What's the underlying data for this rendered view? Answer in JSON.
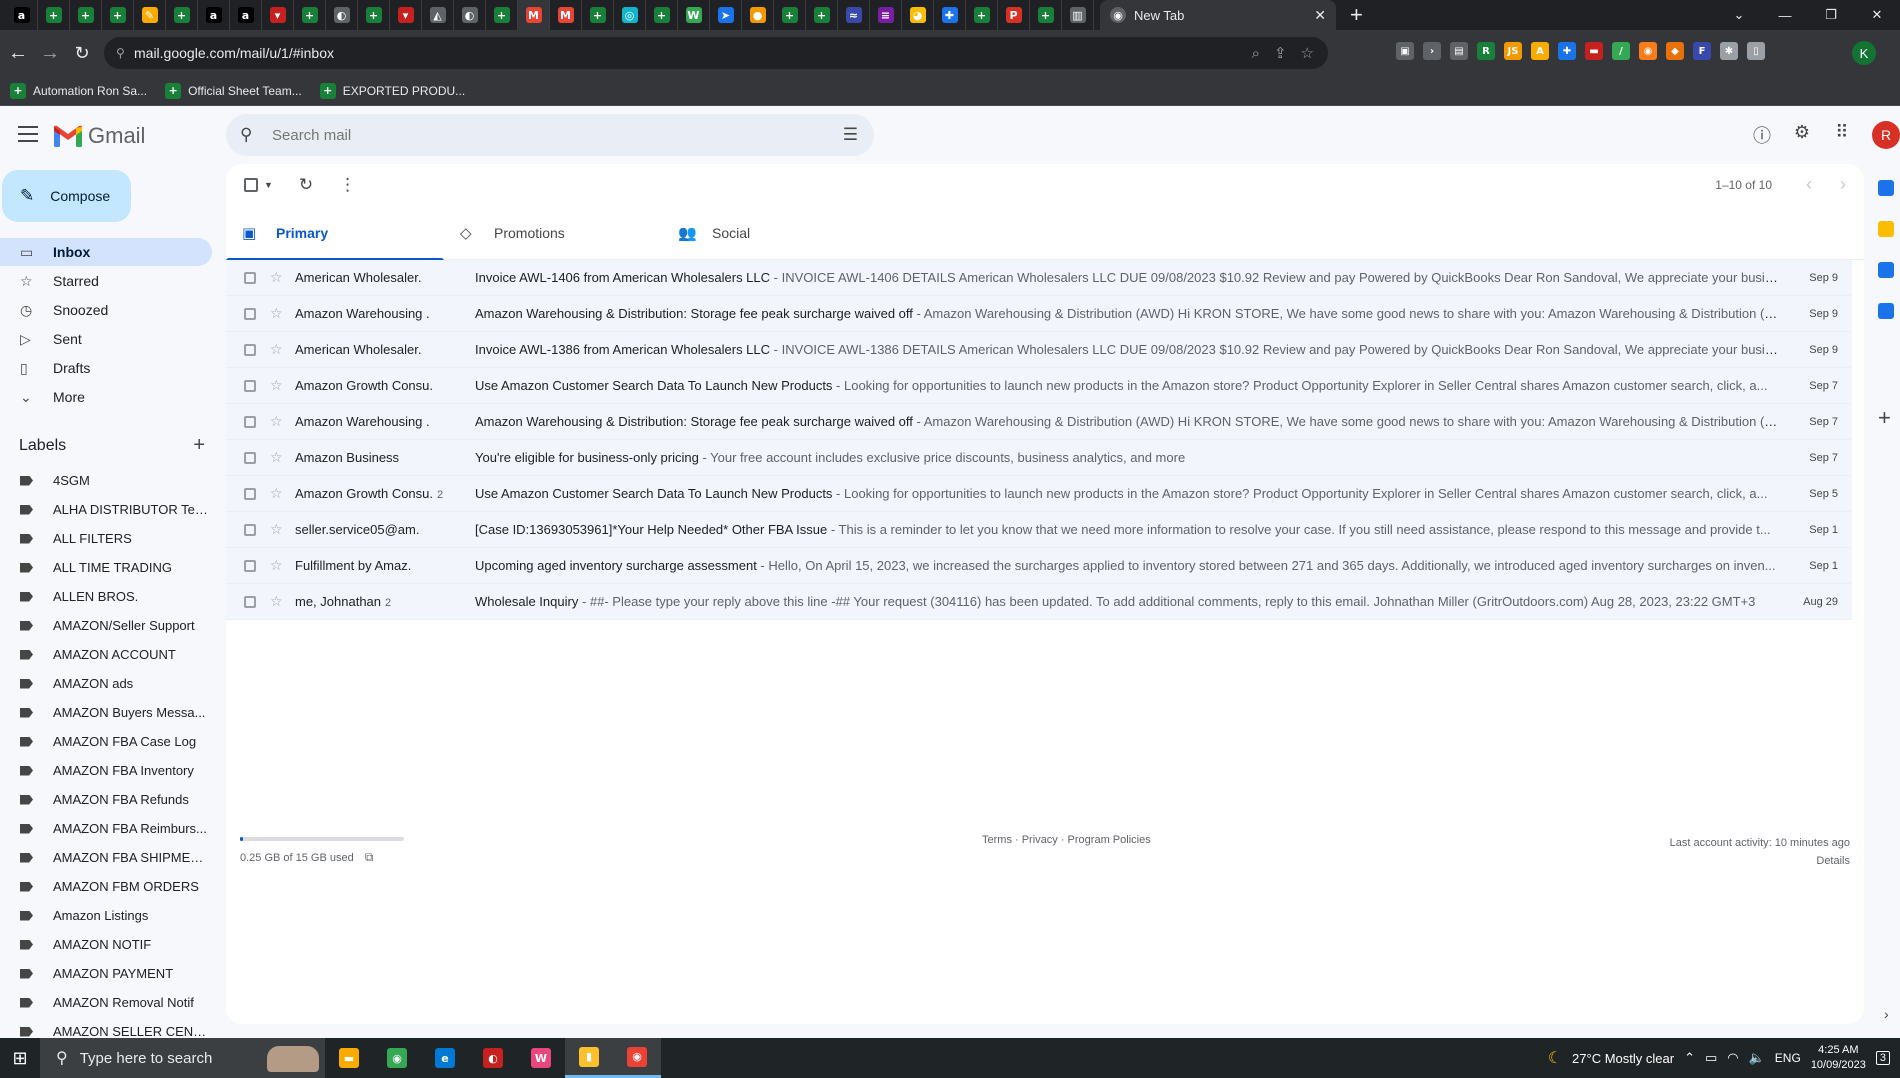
{
  "browser": {
    "pinned_tabs": [
      {
        "glyph": "a",
        "color": "#000000"
      },
      {
        "glyph": "+",
        "color": "#188038"
      },
      {
        "glyph": "+",
        "color": "#188038"
      },
      {
        "glyph": "+",
        "color": "#188038"
      },
      {
        "glyph": "✎",
        "color": "#f9ab00"
      },
      {
        "glyph": "+",
        "color": "#188038"
      },
      {
        "glyph": "a",
        "color": "#000000"
      },
      {
        "glyph": "a",
        "color": "#000000"
      },
      {
        "glyph": "▾",
        "color": "#c5221f"
      },
      {
        "glyph": "+",
        "color": "#188038"
      },
      {
        "glyph": "◐",
        "color": "#5f6368"
      },
      {
        "glyph": "+",
        "color": "#188038"
      },
      {
        "glyph": "▾",
        "color": "#c5221f"
      },
      {
        "glyph": "◭",
        "color": "#5f6368"
      },
      {
        "glyph": "◐",
        "color": "#5f6368"
      },
      {
        "glyph": "+",
        "color": "#188038"
      },
      {
        "glyph": "M",
        "color": "#ea4335"
      },
      {
        "glyph": "M",
        "color": "#ea4335"
      },
      {
        "glyph": "+",
        "color": "#188038"
      },
      {
        "glyph": "◎",
        "color": "#12b5cb"
      },
      {
        "glyph": "+",
        "color": "#188038"
      },
      {
        "glyph": "W",
        "color": "#34a853"
      },
      {
        "glyph": "➤",
        "color": "#1a73e8"
      },
      {
        "glyph": "●",
        "color": "#f29900"
      },
      {
        "glyph": "+",
        "color": "#188038"
      },
      {
        "glyph": "+",
        "color": "#188038"
      },
      {
        "glyph": "≈",
        "color": "#3949ab"
      },
      {
        "glyph": "≡",
        "color": "#7b1fa2"
      },
      {
        "glyph": "◕",
        "color": "#fbbc04"
      },
      {
        "glyph": "✚",
        "color": "#1a73e8"
      },
      {
        "glyph": "+",
        "color": "#188038"
      },
      {
        "glyph": "P",
        "color": "#d93025"
      },
      {
        "glyph": "+",
        "color": "#188038"
      },
      {
        "glyph": "▥",
        "color": "#5f6368"
      }
    ],
    "active_tab_index": 16,
    "new_tab_label": "New Tab",
    "url": "mail.google.com/mail/u/1/#inbox",
    "profile_initial": "K",
    "bookmarks": [
      "Automation Ron Sa...",
      "Official Sheet Team...",
      "EXPORTED PRODU..."
    ],
    "extensions": [
      {
        "glyph": "▣",
        "color": "#5f6368"
      },
      {
        "glyph": "›",
        "color": "#5f6368"
      },
      {
        "glyph": "▤",
        "color": "#5f6368"
      },
      {
        "glyph": "R",
        "color": "#188038"
      },
      {
        "glyph": "JS",
        "color": "#f29900"
      },
      {
        "glyph": "A",
        "color": "#f9ab00"
      },
      {
        "glyph": "✚",
        "color": "#1a73e8"
      },
      {
        "glyph": "▬",
        "color": "#c5221f"
      },
      {
        "glyph": "/",
        "color": "#34a853"
      },
      {
        "glyph": "◉",
        "color": "#fa7b17"
      },
      {
        "glyph": "◆",
        "color": "#e8710a"
      },
      {
        "glyph": "F",
        "color": "#3949ab"
      },
      {
        "glyph": "✱",
        "color": "#9aa0a6"
      },
      {
        "glyph": "▯",
        "color": "#9aa0a6"
      }
    ]
  },
  "gmail": {
    "product_name": "Gmail",
    "search_placeholder": "Search mail",
    "compose_label": "Compose",
    "account_initial": "R",
    "nav": [
      {
        "label": "Inbox",
        "icon": "▭",
        "selected": true
      },
      {
        "label": "Starred",
        "icon": "☆",
        "selected": false
      },
      {
        "label": "Snoozed",
        "icon": "◷",
        "selected": false
      },
      {
        "label": "Sent",
        "icon": "▷",
        "selected": false
      },
      {
        "label": "Drafts",
        "icon": "▯",
        "selected": false
      },
      {
        "label": "More",
        "icon": "⌄",
        "selected": false
      }
    ],
    "labels_title": "Labels",
    "labels": [
      "4SGM",
      "ALHA DISTRIBUTOR Tea...",
      "ALL FILTERS",
      "ALL TIME TRADING",
      "ALLEN BROS.",
      "AMAZON/Seller Support",
      "AMAZON ACCOUNT",
      "AMAZON ads",
      "AMAZON Buyers Messa...",
      "AMAZON FBA Case Log",
      "AMAZON FBA Inventory",
      "AMAZON FBA Refunds",
      "AMAZON FBA Reimburs...",
      "AMAZON FBA SHIPMEN...",
      "AMAZON FBM ORDERS",
      "Amazon Listings",
      "AMAZON NOTIF",
      "AMAZON PAYMENT",
      "AMAZON Removal Notif",
      "AMAZON SELLER CENT..."
    ],
    "pager": "1–10 of 10",
    "tabs": [
      {
        "label": "Primary",
        "icon": "▣",
        "selected": true
      },
      {
        "label": "Promotions",
        "icon": "◇",
        "selected": false
      },
      {
        "label": "Social",
        "icon": "👥",
        "selected": false
      }
    ],
    "emails": [
      {
        "sender": "American Wholesaler.",
        "count": "",
        "subject": "Invoice AWL-1406 from American Wholesalers LLC",
        "snippet": " - INVOICE AWL-1406 DETAILS American Wholesalers LLC DUE 09/08/2023 $10.92 Review and pay Powered by QuickBooks Dear Ron Sandoval, We appreciate your busines...",
        "date": "Sep 9"
      },
      {
        "sender": "Amazon Warehousing .",
        "count": "",
        "subject": "Amazon Warehousing & Distribution: Storage fee peak surcharge waived off",
        "snippet": " - Amazon Warehousing & Distribution (AWD) Hi KRON STORE, We have some good news to share with you: Amazon Warehousing & Distribution (A...",
        "date": "Sep 9"
      },
      {
        "sender": "American Wholesaler.",
        "count": "",
        "subject": "Invoice AWL-1386 from American Wholesalers LLC",
        "snippet": " - INVOICE AWL-1386 DETAILS American Wholesalers LLC DUE 09/08/2023 $10.92 Review and pay Powered by QuickBooks Dear Ron Sandoval, We appreciate your business...",
        "date": "Sep 9"
      },
      {
        "sender": "Amazon Growth Consu.",
        "count": "",
        "subject": "Use Amazon Customer Search Data To Launch New Products",
        "snippet": " - Looking for opportunities to launch new products in the Amazon store? Product Opportunity Explorer in Seller Central shares Amazon customer search, click, a...",
        "date": "Sep 7"
      },
      {
        "sender": "Amazon Warehousing .",
        "count": "",
        "subject": "Amazon Warehousing & Distribution: Storage fee peak surcharge waived off",
        "snippet": " - Amazon Warehousing & Distribution (AWD) Hi KRON STORE, We have some good news to share with you: Amazon Warehousing & Distribution (A...",
        "date": "Sep 7"
      },
      {
        "sender": "Amazon Business",
        "count": "",
        "subject": "You're eligible for business-only pricing",
        "snippet": " - Your free account includes exclusive price discounts, business analytics, and more",
        "date": "Sep 7"
      },
      {
        "sender": "Amazon Growth Consu.",
        "count": "2",
        "subject": "Use Amazon Customer Search Data To Launch New Products",
        "snippet": " - Looking for opportunities to launch new products in the Amazon store? Product Opportunity Explorer in Seller Central shares Amazon customer search, click, a...",
        "date": "Sep 5"
      },
      {
        "sender": "seller.service05@am.",
        "count": "",
        "subject": "[Case ID:13693053961]*Your Help Needed* Other FBA Issue",
        "snippet": " - This is a reminder to let you know that we need more information to resolve your case. If you still need assistance, please respond to this message and provide t...",
        "date": "Sep 1"
      },
      {
        "sender": "Fulfillment by Amaz.",
        "count": "",
        "subject": "Upcoming aged inventory surcharge assessment",
        "snippet": " - Hello, On April 15, 2023, we increased the surcharges applied to inventory stored between 271 and 365 days. Additionally, we introduced aged inventory surcharges on inven...",
        "date": "Sep 1"
      },
      {
        "sender": "me, Johnathan",
        "count": "2",
        "subject": "Wholesale Inquiry",
        "snippet": " - ##- Please type your reply above this line -## Your request (304116) has been updated. To add additional comments, reply to this email. Johnathan Miller (GritrOutdoors.com) Aug 28, 2023, 23:22 GMT+3",
        "date": "Aug 29"
      }
    ],
    "footer": {
      "storage_text": "0.25 GB of 15 GB used",
      "storage_fraction": 0.017,
      "links": "Terms · Privacy · Program Policies",
      "last_activity": "Last account activity: 10 minutes ago",
      "details": "Details"
    },
    "side_rail": [
      {
        "name": "calendar-icon",
        "color": "#1a73e8"
      },
      {
        "name": "keep-icon",
        "color": "#fbbc04"
      },
      {
        "name": "tasks-icon",
        "color": "#1a73e8"
      },
      {
        "name": "contacts-icon",
        "color": "#1a73e8"
      }
    ]
  },
  "taskbar": {
    "search_placeholder": "Type here to search",
    "apps": [
      {
        "name": "file-explorer-icon",
        "glyph": "▬",
        "color": "#f9ab00",
        "open": false
      },
      {
        "name": "chrome-icon",
        "glyph": "◉",
        "color": "#34a853",
        "open": false
      },
      {
        "name": "edge-icon",
        "glyph": "e",
        "color": "#0078d4",
        "open": false
      },
      {
        "name": "app-icon",
        "glyph": "◐",
        "color": "#c5221f",
        "open": false
      },
      {
        "name": "app-icon-2",
        "glyph": "W",
        "color": "#e8467c",
        "open": false
      },
      {
        "name": "sticky-notes-icon",
        "glyph": "▮",
        "color": "#fbc02d",
        "open": true
      },
      {
        "name": "chrome-profile-icon",
        "glyph": "◉",
        "color": "#ea4335",
        "open": true
      }
    ],
    "weather": "27°C  Mostly clear",
    "language": "ENG",
    "time": "4:25 AM",
    "date": "10/09/2023",
    "notifications": "3"
  }
}
